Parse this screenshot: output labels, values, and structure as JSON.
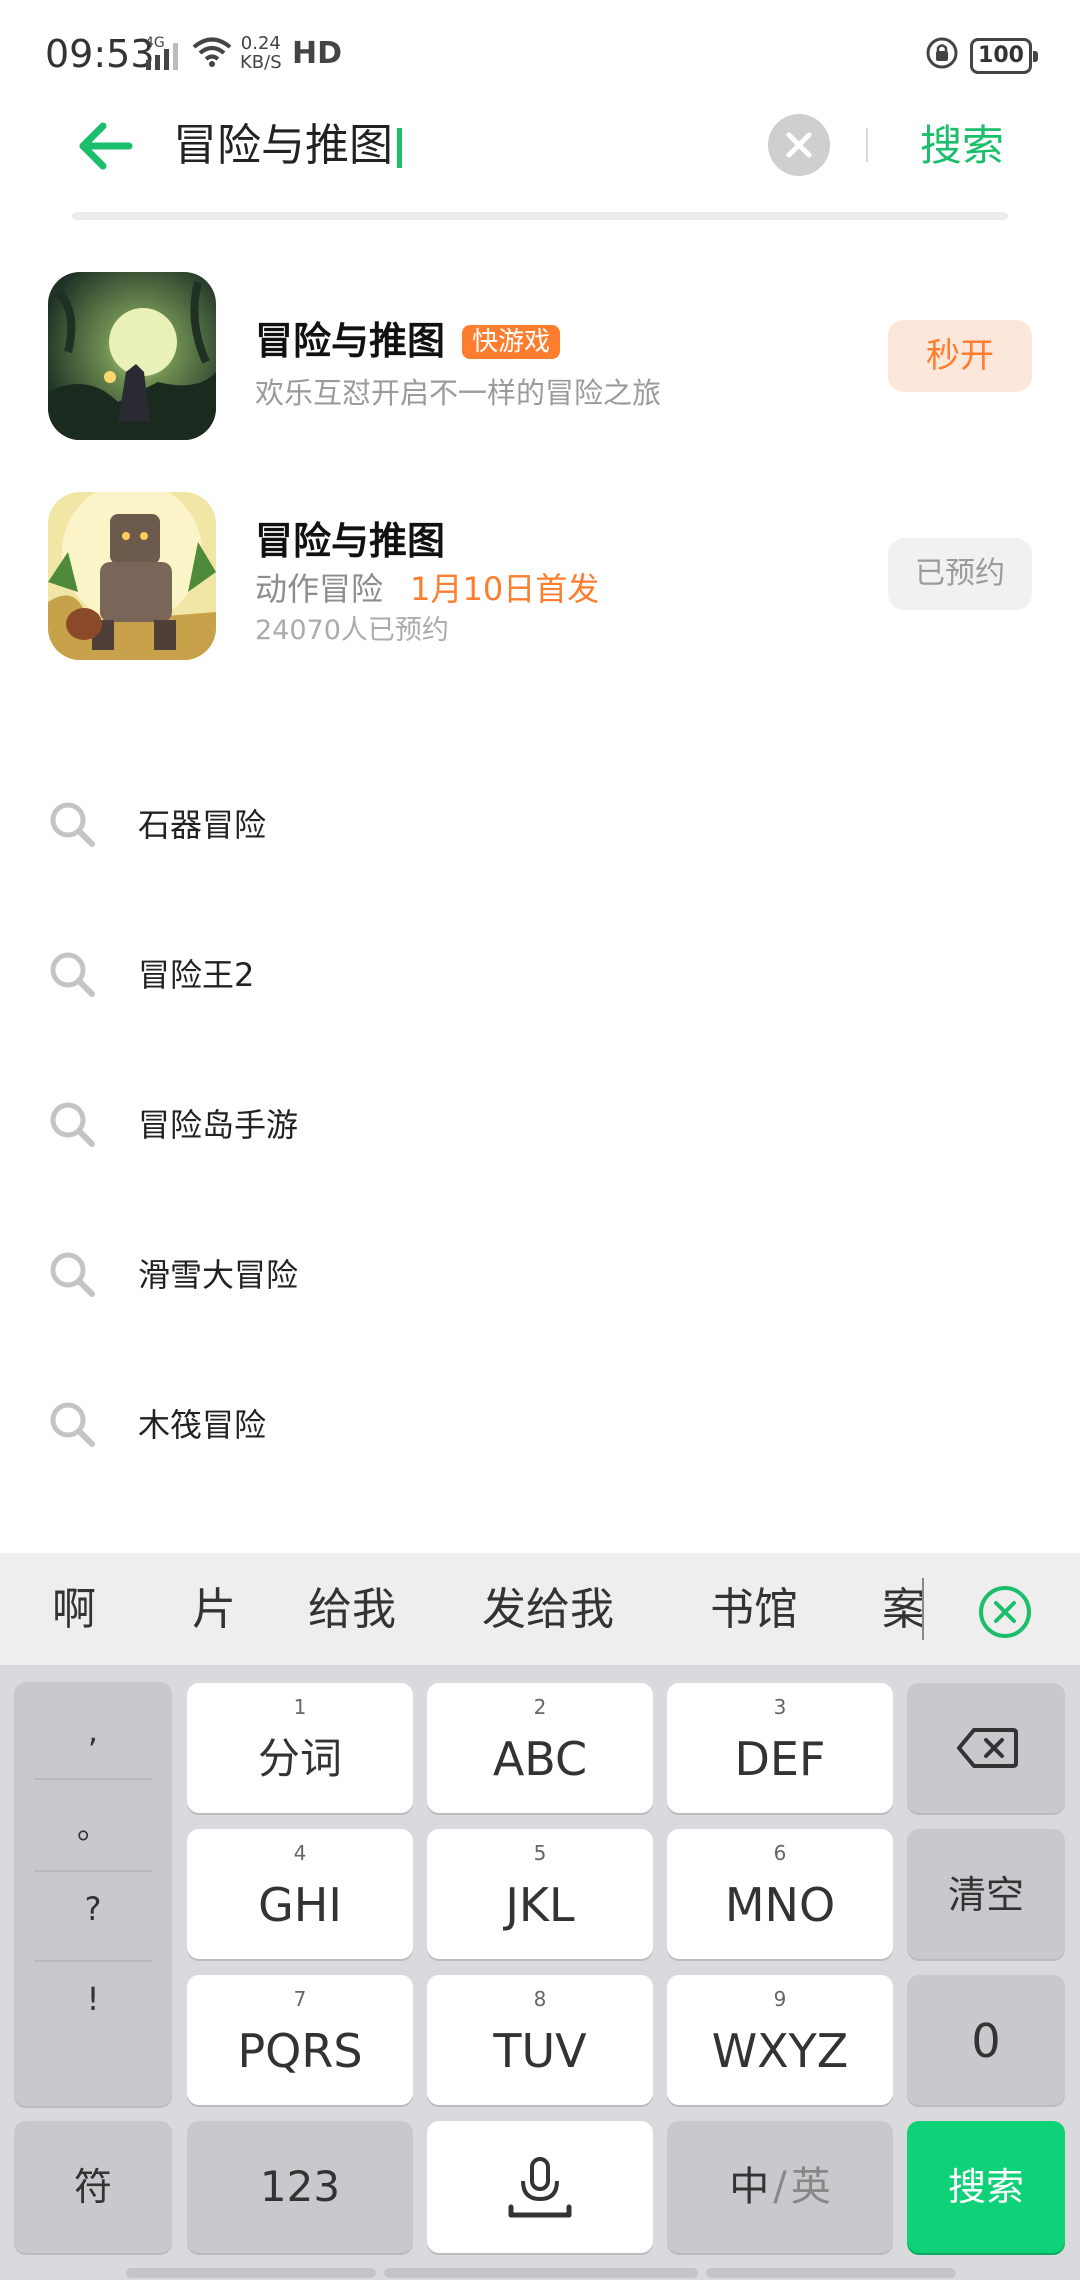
{
  "status_bar": {
    "time": "09:53",
    "network": "4G",
    "speed_value": "0.24",
    "speed_unit": "KB/S",
    "hd": "HD",
    "battery": "100"
  },
  "search": {
    "query": "冒险与推图",
    "submit_label": "搜索"
  },
  "results": [
    {
      "name": "冒险与推图",
      "badge": "快游戏",
      "subtitle": "欢乐互怼开启不一样的冒险之旅",
      "action": "秒开"
    },
    {
      "name": "冒险与推图",
      "category": "动作冒险",
      "release": "1月10日首发",
      "reservations": "24070人已预约",
      "action": "已预约"
    }
  ],
  "suggestions": [
    "石器冒险",
    "冒险王2",
    "冒险岛手游",
    "滑雪大冒险",
    "木筏冒险"
  ],
  "keyboard": {
    "candidates": [
      "啊",
      "片",
      "给我",
      "发给我",
      "书馆",
      "案"
    ],
    "punctuation": [
      ",",
      "。",
      "?",
      "!"
    ],
    "keys": [
      {
        "num": "1",
        "label": "分词"
      },
      {
        "num": "2",
        "label": "ABC"
      },
      {
        "num": "3",
        "label": "DEF"
      },
      {
        "num": "4",
        "label": "GHI"
      },
      {
        "num": "5",
        "label": "JKL"
      },
      {
        "num": "6",
        "label": "MNO"
      },
      {
        "num": "7",
        "label": "PQRS"
      },
      {
        "num": "8",
        "label": "TUV"
      },
      {
        "num": "9",
        "label": "WXYZ"
      }
    ],
    "clear_label": "清空",
    "zero_label": "0",
    "symbol_label": "符",
    "numeric_label": "123",
    "lang_zh": "中",
    "lang_sep": "/",
    "lang_en": "英",
    "search_label": "搜索"
  },
  "colors": {
    "accent_green": "#1bbf6b",
    "orange": "#ff7d2e",
    "key_green": "#0fd178"
  }
}
